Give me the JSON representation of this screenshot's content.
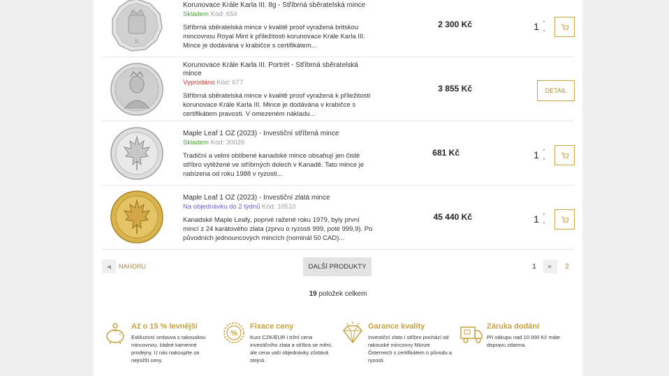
{
  "products": [
    {
      "name": "Korunovace Krále Karla III. 8g - Stříbrná sběratelská mince",
      "stock": "Skladem",
      "code": "Kód: 654",
      "description": "Stříbrná sběratelská mince v kvalitě proof vyražená britskou mincovnou Royal Mint k příležitosti korunovace Krále Karla III. Mince je dodávána v krabičce s certifikátem...",
      "price": "2 300 Kč",
      "quantity": "1"
    },
    {
      "name": "Korunovace Krále Karla III. Portrét - Stříbrná sběratelská mince",
      "stock": "Vyprodáno",
      "code": "Kód: 677",
      "description": "Stříbrná sběratelská mince v kvalitě proof vyražená k příležitosti korunovace Krále Karla III. Mince je dodávána v krabičce s certifikátem pravosti. V omezeném nákladu...",
      "price": "3 855 Kč",
      "button": "DETAIL"
    },
    {
      "name": "Maple Leaf 1 OZ (2023) - Investiční stříbrná mince",
      "stock": "Skladem",
      "code": "Kód: 30026",
      "description": "Tradiční a velmi oblíbené kanadské mince obsahují  jen čisté stříbro vytěžené ve stříbrných dolech v Kanadě. Tato mince je nabízena od roku 1988 v ryzosti...",
      "price": "681 Kč",
      "quantity": "1"
    },
    {
      "name": "Maple Leaf 1 OZ (2023) - Investiční zlatá mince",
      "stock": "Na objednávku do 2 týdnů",
      "code": "Kód: 10510",
      "description": "Kanadské Maple Leafy, poprvé ražené roku 1979, byly první mincí z 24 karátového zlata (zprvu o ryzosti 999, poté 999,9). Po původních jednouncových mincích (nominál 50 CAD)...",
      "price": "45 440 Kč",
      "quantity": "1"
    }
  ],
  "nav": {
    "top_label": "NAHORU",
    "more_label": "DALŠÍ PRODUKTY",
    "page_current": "1",
    "page_next": "2"
  },
  "total": {
    "count": "19",
    "label": " položek celkem"
  },
  "benefits": [
    {
      "icon": "piggy-bank-icon",
      "title": "Až o 15 % levnější",
      "text": "Exkluzivní smlouva s rakouskou mincovnou, žádné kamenné prodejny. U nás nakoupíte za nejnižší ceny."
    },
    {
      "icon": "percent-badge-icon",
      "title": "Fixace ceny",
      "text": "Kurz CZK/EUR i tržní cena investičního zlata a stříbra se mění, ale cena vaší objednávky zůstává stejná."
    },
    {
      "icon": "diamond-icon",
      "title": "Garance kvality",
      "text": "Investiční zlato i stříbro pochází od rakouské mincovny Münze Österreich s certifikátem o původu a ryzosti."
    },
    {
      "icon": "delivery-truck-icon",
      "title": "Záruka dodání",
      "text": "Při nákupu nad 10 000 Kč máte dopravu zdarma."
    }
  ],
  "colors": {
    "gold_accent": "#c9a23e",
    "in_stock": "#4aa531",
    "sold_out": "#d2332b",
    "on_order": "#6f5bd3"
  }
}
